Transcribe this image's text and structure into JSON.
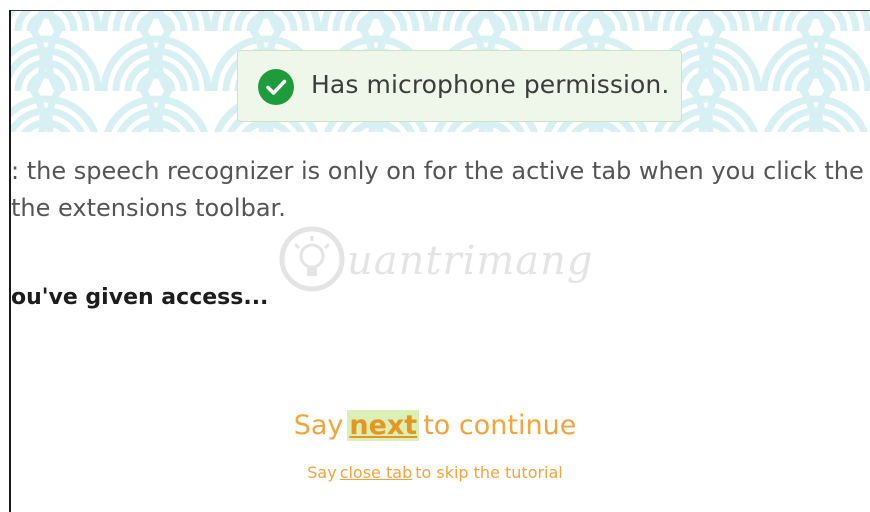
{
  "toast": {
    "message": "Has microphone permission.",
    "icon": "check-circle-icon",
    "icon_color": "#1e9b3a"
  },
  "info": {
    "line1": ": the speech recognizer is only on for the active tab when you click the",
    "line2": "the extensions toolbar."
  },
  "heading": "ou've given access...",
  "watermark": {
    "text": "uantrimang"
  },
  "primary_prompt": {
    "prefix": "Say",
    "command": "next",
    "suffix": "to continue"
  },
  "secondary_prompt": {
    "prefix": "Say",
    "command": "close tab",
    "suffix": "to skip the tutorial"
  },
  "colors": {
    "accent": "#f5a33a",
    "toast_bg": "#eef7ea",
    "header_pattern": "#d6f0f3"
  }
}
